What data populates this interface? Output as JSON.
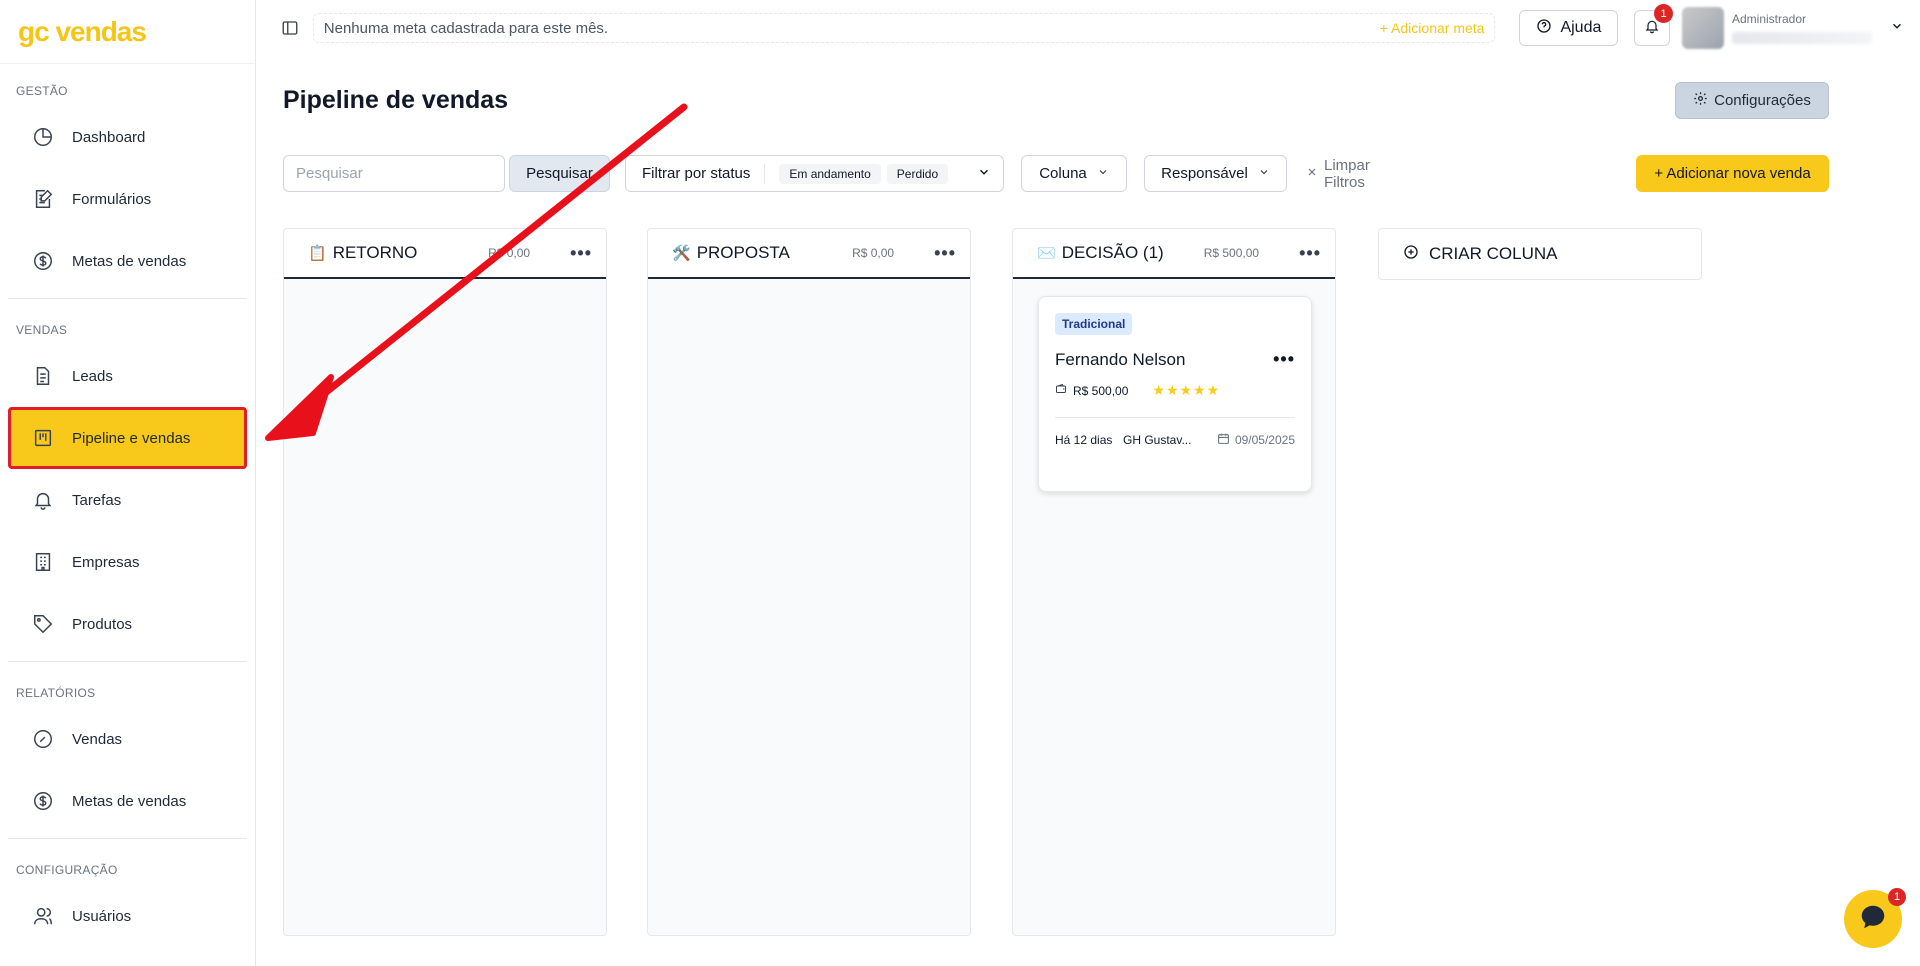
{
  "app": {
    "logo": "gc vendas"
  },
  "sidebar": {
    "sections": [
      {
        "title": "GESTÃO",
        "items": [
          {
            "label": "Dashboard",
            "icon": "pie-chart-icon"
          },
          {
            "label": "Formulários",
            "icon": "form-edit-icon"
          },
          {
            "label": "Metas de vendas",
            "icon": "dollar-circle-icon"
          }
        ]
      },
      {
        "title": "VENDAS",
        "items": [
          {
            "label": "Leads",
            "icon": "document-icon"
          },
          {
            "label": "Pipeline e vendas",
            "icon": "kanban-icon",
            "active": true
          },
          {
            "label": "Tarefas",
            "icon": "bell-icon"
          },
          {
            "label": "Empresas",
            "icon": "building-icon"
          },
          {
            "label": "Produtos",
            "icon": "tag-icon"
          }
        ]
      },
      {
        "title": "RELATÓRIOS",
        "items": [
          {
            "label": "Vendas",
            "icon": "gauge-icon"
          },
          {
            "label": "Metas de vendas",
            "icon": "dollar-circle-icon"
          }
        ]
      },
      {
        "title": "CONFIGURAÇÃO",
        "items": [
          {
            "label": "Usuários",
            "icon": "users-icon"
          }
        ]
      }
    ]
  },
  "topbar": {
    "meta_text": "Nenhuma meta cadastrada para este mês.",
    "add_meta": "+ Adicionar meta",
    "help": "Ajuda",
    "notifications_count": "1",
    "user_role": "Administrador"
  },
  "main": {
    "title": "Pipeline de vendas",
    "config_button": "Configurações",
    "search_placeholder": "Pesquisar",
    "search_button": "Pesquisar",
    "status_filter_label": "Filtrar por status",
    "status_chips": [
      "Em andamento",
      "Perdido"
    ],
    "coluna_label": "Coluna",
    "responsavel_label": "Responsável",
    "clear_filters": "Limpar Filtros",
    "add_sale": "+ Adicionar nova venda",
    "create_column": "CRIAR COLUNA"
  },
  "columns": [
    {
      "icon": "📋",
      "title": "RETORNO",
      "total": "R$ 0,00"
    },
    {
      "icon": "🛠️",
      "title": "PROPOSTA",
      "total": "R$ 0,00"
    },
    {
      "icon": "✉️",
      "title": "DECISÃO (1)",
      "total": "R$ 500,00"
    }
  ],
  "card": {
    "tag": "Tradicional",
    "name": "Fernando Nelson",
    "value": "R$ 500,00",
    "rating": 5,
    "ago": "Há 12 dias",
    "responsible": "GH Gustav...",
    "date": "09/05/2025"
  },
  "chat": {
    "badge": "1"
  },
  "colors": {
    "accent": "#f8c81a",
    "highlight_border": "#e11d2a",
    "arrow": "#e8111b"
  }
}
